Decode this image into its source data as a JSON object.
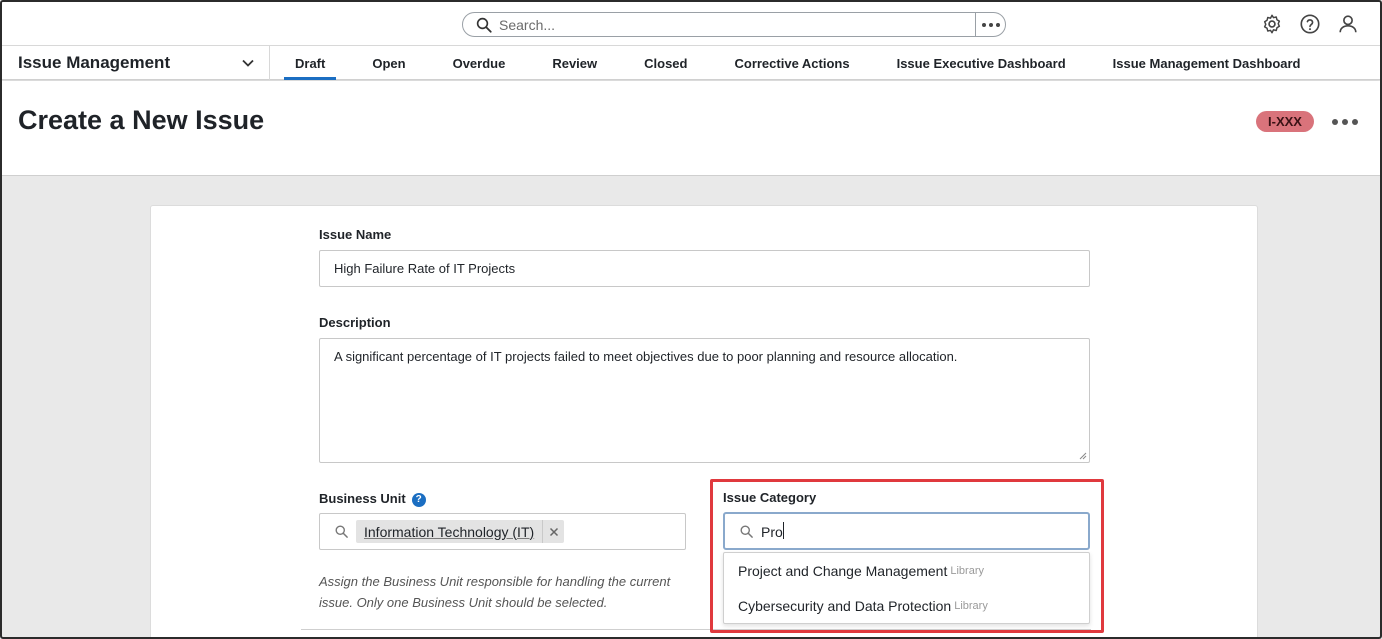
{
  "search": {
    "placeholder": "Search..."
  },
  "app": {
    "title": "Issue Management"
  },
  "tabs": [
    {
      "label": "Draft",
      "active": true
    },
    {
      "label": "Open"
    },
    {
      "label": "Overdue"
    },
    {
      "label": "Review"
    },
    {
      "label": "Closed"
    },
    {
      "label": "Corrective Actions"
    },
    {
      "label": "Issue Executive Dashboard"
    },
    {
      "label": "Issue Management Dashboard"
    }
  ],
  "page": {
    "title": "Create a New Issue",
    "id_badge": "I-XXX"
  },
  "form": {
    "issue_name": {
      "label": "Issue Name",
      "value": "High Failure Rate of IT Projects"
    },
    "description": {
      "label": "Description",
      "value": "A significant percentage of IT projects failed to meet objectives due to poor planning and resource allocation."
    },
    "business_unit": {
      "label": "Business Unit",
      "selected": "Information Technology (IT)",
      "hint": "Assign the Business Unit responsible for handling the current issue. Only one Business Unit should be selected."
    },
    "issue_category": {
      "label": "Issue Category",
      "query": "Pro",
      "options": [
        {
          "name": "Project and Change Management",
          "tag": "Library"
        },
        {
          "name": "Cybersecurity and Data Protection",
          "tag": "Library"
        }
      ]
    }
  },
  "colors": {
    "accent": "#1b6ec2",
    "badge": "#d9737b",
    "highlight": "#e0393e"
  },
  "icons": [
    "search-icon",
    "more-icon",
    "gear-icon",
    "help-icon",
    "user-icon",
    "chevron-down-icon",
    "close-icon"
  ]
}
